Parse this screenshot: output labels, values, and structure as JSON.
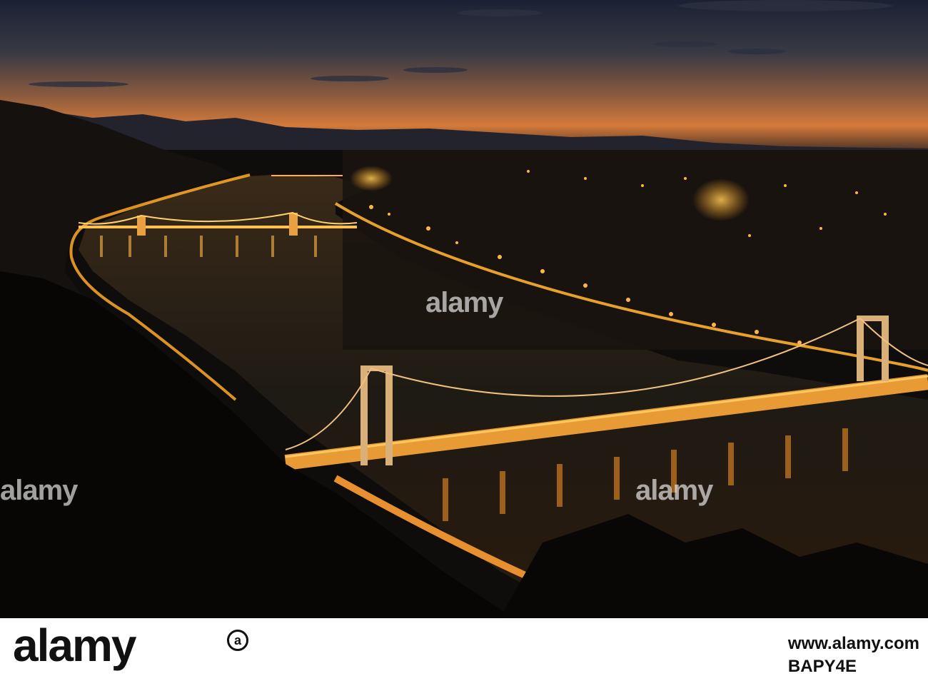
{
  "photo": {
    "watermark_text": "alamy",
    "description_colors": {
      "sky_top": "#1d2235",
      "sky_horizon": "#c9763c",
      "water": "#1a1812",
      "lights": "#ffb02e"
    }
  },
  "footer": {
    "logo_text": "alamy",
    "logo_mark": "a",
    "site": "www.alamy.com",
    "image_id": "BAPY4E"
  }
}
